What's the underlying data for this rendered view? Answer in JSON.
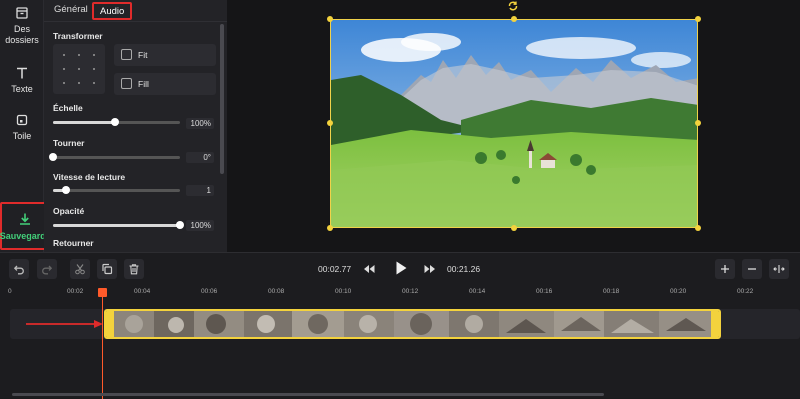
{
  "sidebar": {
    "items": [
      {
        "label": "Des\ndossiers",
        "icon": "folder-icon"
      },
      {
        "label": "Texte",
        "icon": "text-icon"
      },
      {
        "label": "Toile",
        "icon": "canvas-icon"
      }
    ],
    "save_label": "Sauvegarder",
    "save_icon": "download-icon"
  },
  "panel": {
    "tabs": [
      {
        "label": "Général"
      },
      {
        "label": "Audio"
      }
    ],
    "active_tab": "Audio",
    "transform": {
      "title": "Transformer",
      "fit_label": "Fit",
      "fill_label": "Fill"
    },
    "scale": {
      "title": "Échelle",
      "value": "100%",
      "level": 0.49
    },
    "rotate": {
      "title": "Tourner",
      "value": "0°",
      "level": 0.0
    },
    "speed": {
      "title": "Vitesse de lecture",
      "value": "1",
      "level": 0.1
    },
    "opacity": {
      "title": "Opacité",
      "value": "100%",
      "level": 1.0
    },
    "flip": {
      "title": "Retourner"
    }
  },
  "timeline": {
    "current_time": "00:02.77",
    "total_time": "00:21.26",
    "ruler": [
      "0",
      "00:02",
      "00:04",
      "00:06",
      "00:08",
      "00:10",
      "00:12",
      "00:14",
      "00:16",
      "00:18",
      "00:20",
      "00:22"
    ],
    "buttons": {
      "undo_icon": "undo-icon",
      "redo_icon": "redo-icon",
      "cut_icon": "scissors-icon",
      "duplicate_icon": "duplicate-icon",
      "delete_icon": "trash-icon",
      "rewind_icon": "rewind-icon",
      "play_icon": "play-icon",
      "forward_icon": "fast-forward-icon",
      "zoom_in_icon": "plus-icon",
      "zoom_out_icon": "minus-icon",
      "fit_icon": "fit-width-icon"
    }
  },
  "colors": {
    "accent_yellow": "#f3d23d",
    "highlight_red": "#e02b2b",
    "save_green": "#43d07a",
    "playhead": "#ff5a2a"
  }
}
